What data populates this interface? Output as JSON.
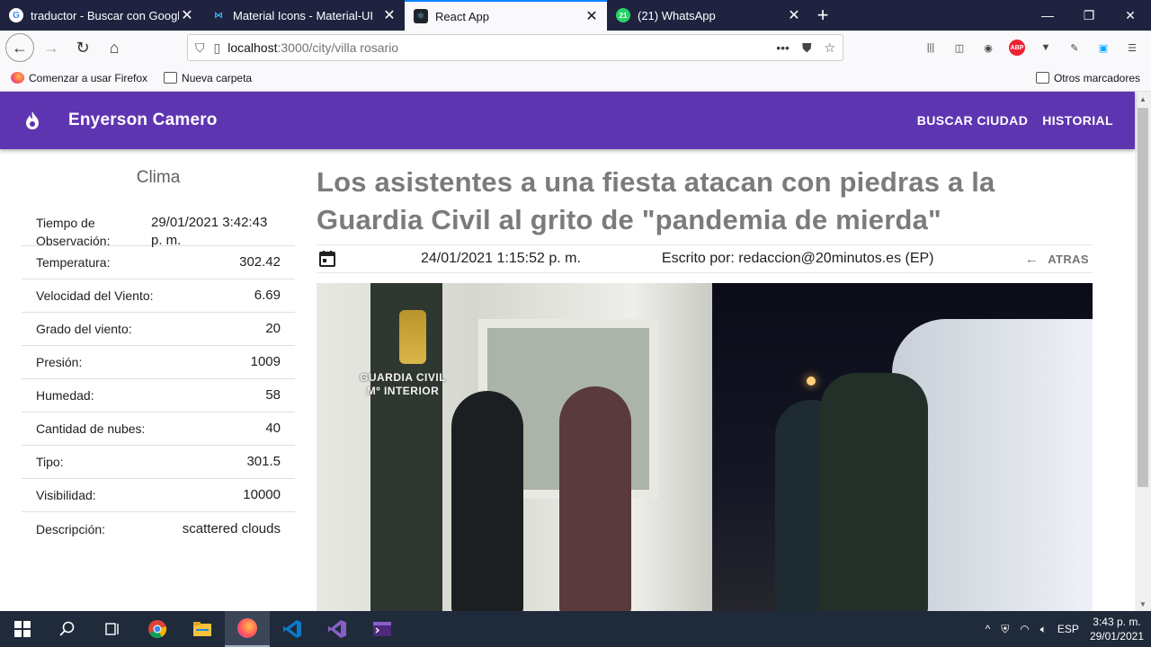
{
  "browser": {
    "tabs": [
      {
        "title": "traductor - Buscar con Google",
        "favicon": "google-icon",
        "active": false
      },
      {
        "title": "Material Icons - Material-UI",
        "favicon": "material-ui-icon",
        "active": false
      },
      {
        "title": "React App",
        "favicon": "react-icon",
        "active": true
      },
      {
        "title": "(21) WhatsApp",
        "favicon": "whatsapp-icon",
        "active": false
      }
    ],
    "url_host": "localhost",
    "url_path": ":3000/city/villa rosario",
    "bookmarks": [
      "Comenzar a usar Firefox",
      "Nueva carpeta"
    ],
    "other_bookmarks": "Otros marcadores",
    "abp_label": "ABP"
  },
  "app": {
    "brand": "Enyerson Camero",
    "nav": [
      "BUSCAR CIUDAD",
      "HISTORIAL"
    ],
    "accent": "#5e35b1"
  },
  "clima": {
    "title": "Clima",
    "rows": [
      {
        "label": "Tiempo de Observación:",
        "value": "29/01/2021 3:42:43 p. m."
      },
      {
        "label": "Temperatura:",
        "value": "302.42"
      },
      {
        "label": "Velocidad del Viento:",
        "value": "6.69"
      },
      {
        "label": "Grado del viento:",
        "value": "20"
      },
      {
        "label": "Presión:",
        "value": "1009"
      },
      {
        "label": "Humedad:",
        "value": "58"
      },
      {
        "label": "Cantidad de nubes:",
        "value": "40"
      },
      {
        "label": "Tipo:",
        "value": "301.5"
      },
      {
        "label": "Visibilidad:",
        "value": "10000"
      },
      {
        "label": "Descripción:",
        "value": "scattered clouds"
      }
    ]
  },
  "article": {
    "headline": "Los asistentes a una fiesta atacan con piedras a la Guardia Civil al grito de \"pandemia de mierda\"",
    "date": "24/01/2021 1:15:52 p. m.",
    "author": "Escrito por: redaccion@20minutos.es (EP)",
    "back_label": "ATRAS",
    "photo_watermark_line1": "GUARDIA CIVIL",
    "photo_watermark_line2": "Mº INTERIOR"
  },
  "taskbar": {
    "lang": "ESP",
    "time": "3:43 p. m.",
    "date": "29/01/2021"
  }
}
